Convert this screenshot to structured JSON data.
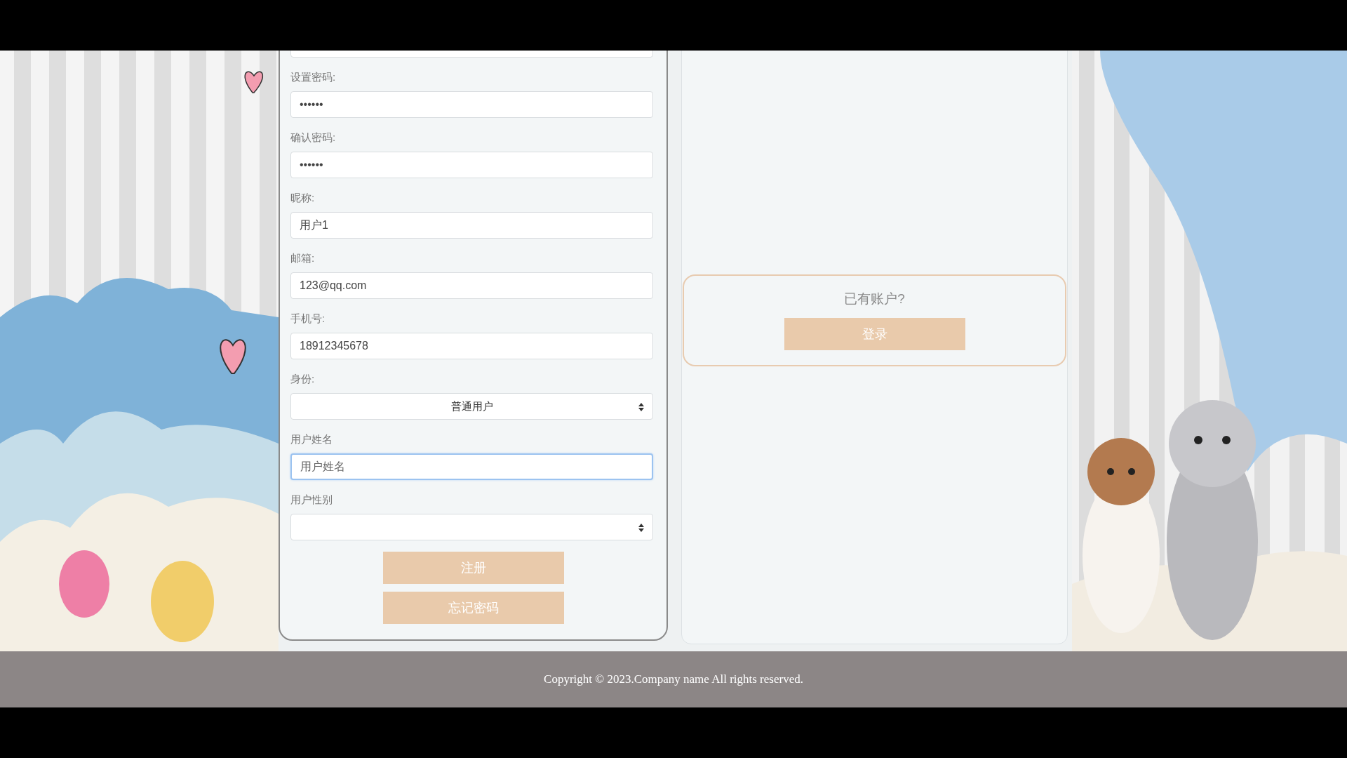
{
  "form": {
    "fields": [
      {
        "kind": "input",
        "label": "设置密码:",
        "value": "••••••",
        "focused": false
      },
      {
        "kind": "input",
        "label": "确认密码:",
        "value": "••••••",
        "focused": false
      },
      {
        "kind": "input",
        "label": "昵称:",
        "value": "用户1",
        "focused": false
      },
      {
        "kind": "input",
        "label": "邮箱:",
        "value": "123@qq.com",
        "focused": false
      },
      {
        "kind": "input",
        "label": "手机号:",
        "value": "18912345678",
        "focused": false
      },
      {
        "kind": "select",
        "label": "身份:",
        "value": "普通用户",
        "focused": false
      },
      {
        "kind": "input",
        "label": "用户姓名",
        "placeholder": "用户姓名",
        "focused": true
      },
      {
        "kind": "select",
        "label": "用户性别",
        "focused": false
      }
    ],
    "buttons": [
      "注册",
      "忘记密码"
    ]
  },
  "login_box": {
    "prompt": "已有账户?",
    "button": "登录"
  },
  "footer": {
    "text": "Copyright © 2023.Company name All rights reserved."
  }
}
